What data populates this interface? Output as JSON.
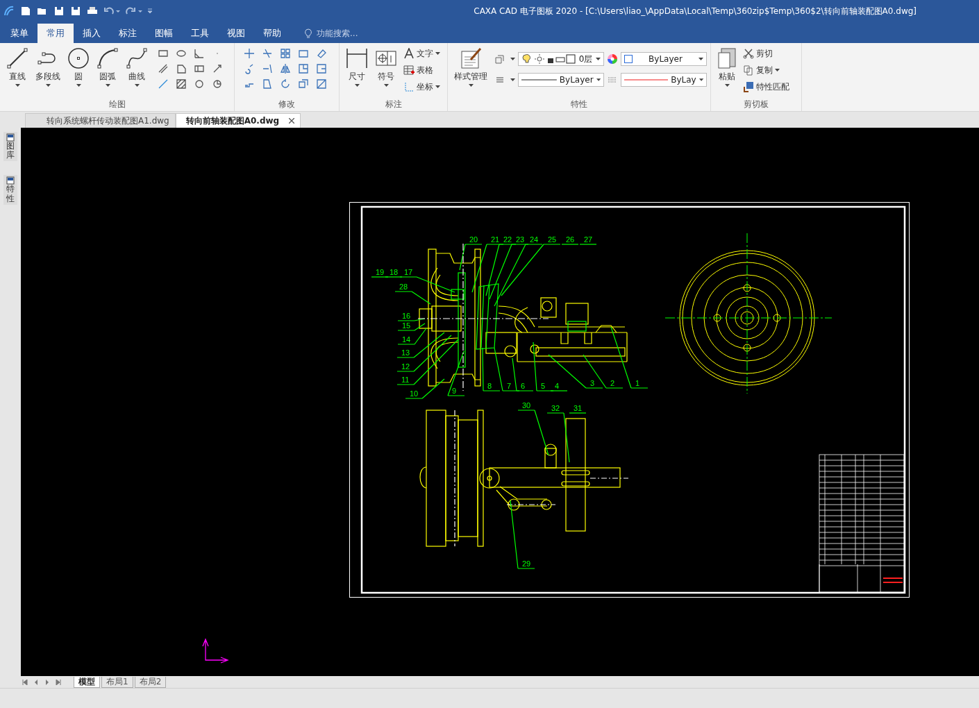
{
  "title_bar": {
    "title": "CAXA CAD 电子图板 2020 - [C:\\Users\\liao_\\AppData\\Local\\Temp\\360zip$Temp\\360$2\\转向前轴装配图A0.dwg]"
  },
  "menu_tabs": [
    {
      "label": "菜单",
      "selected": false
    },
    {
      "label": "常用",
      "selected": true
    },
    {
      "label": "插入",
      "selected": false
    },
    {
      "label": "标注",
      "selected": false
    },
    {
      "label": "图幅",
      "selected": false
    },
    {
      "label": "工具",
      "selected": false
    },
    {
      "label": "视图",
      "selected": false
    },
    {
      "label": "帮助",
      "selected": false
    }
  ],
  "search": {
    "placeholder": "功能搜索..."
  },
  "ribbon": {
    "draw": {
      "title": "绘图",
      "tools": [
        "直线",
        "多段线",
        "圆",
        "圆弧",
        "曲线"
      ]
    },
    "modify": {
      "title": "修改"
    },
    "annotate": {
      "title": "标注",
      "large": [
        "尺寸",
        "符号"
      ],
      "small": [
        "文字",
        "表格",
        "坐标"
      ]
    },
    "properties": {
      "title": "特性",
      "style": "样式管理",
      "layer": "0层",
      "color_setting": "ByLayer",
      "linetype": "ByLayer",
      "lineweight": "ByLay"
    },
    "clipboard": {
      "title": "剪切板",
      "paste": "粘贴",
      "actions": [
        "剪切",
        "复制",
        "特性匹配"
      ]
    }
  },
  "document_tabs": [
    {
      "label": "转向系统螺杆传动装配图A1.dwg",
      "selected": false
    },
    {
      "label": "转向前轴装配图A0.dwg",
      "selected": true
    }
  ],
  "side_panel": [
    "图库",
    "特性"
  ],
  "drawing": {
    "part_numbers": [
      "20",
      "21",
      "22",
      "23",
      "24",
      "25",
      "26",
      "27",
      "19",
      "18",
      "17",
      "28",
      "16",
      "15",
      "14",
      "13",
      "12",
      "11",
      "10",
      "9",
      "8",
      "7",
      "6",
      "5",
      "4",
      "3",
      "2",
      "1",
      "30",
      "32",
      "31",
      "29"
    ]
  },
  "layout_tabs": [
    {
      "label": "模型",
      "selected": true
    },
    {
      "label": "布局1",
      "selected": false
    },
    {
      "label": "布局2",
      "selected": false
    }
  ]
}
